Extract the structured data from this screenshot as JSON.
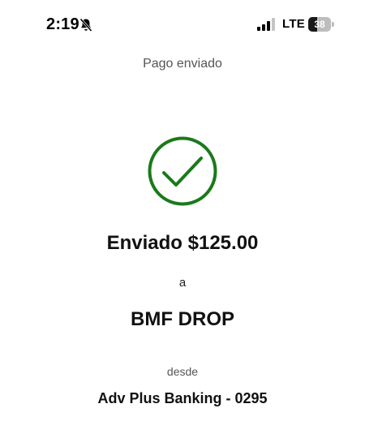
{
  "status_bar": {
    "time": "2:19",
    "network": "LTE",
    "battery_level": "38",
    "battery_fraction": 0.38,
    "icons": [
      "bell-slash-icon",
      "signal-icon",
      "battery-icon"
    ]
  },
  "header": {
    "title": "Pago enviado"
  },
  "confirmation": {
    "icon": "checkmark-circle-icon",
    "accent_color": "#1a7a1a",
    "amount_text": "Enviado $125.00",
    "to_label": "a",
    "recipient": "BMF DROP",
    "from_label": "desde",
    "account": "Adv Plus Banking - 0295"
  }
}
